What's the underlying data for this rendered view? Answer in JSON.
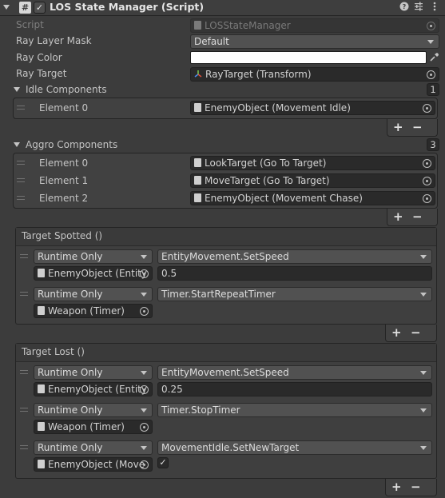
{
  "header": {
    "title": "LOS State Manager (Script)",
    "enabled_mark": "✓"
  },
  "fields": {
    "script": {
      "label": "Script",
      "value": "LOSStateManager"
    },
    "ray_layer_mask": {
      "label": "Ray Layer Mask",
      "value": "Default"
    },
    "ray_color": {
      "label": "Ray Color",
      "value": "#ffffff"
    },
    "ray_target": {
      "label": "Ray Target",
      "value": "RayTarget (Transform)"
    }
  },
  "idle": {
    "label": "Idle Components",
    "count": "1",
    "elements": [
      {
        "label": "Element 0",
        "value": "EnemyObject (Movement Idle)"
      }
    ]
  },
  "aggro": {
    "label": "Aggro Components",
    "count": "3",
    "elements": [
      {
        "label": "Element 0",
        "value": "LookTarget (Go To Target)"
      },
      {
        "label": "Element 1",
        "value": "MoveTarget (Go To Target)"
      },
      {
        "label": "Element 2",
        "value": "EnemyObject (Movement Chase)"
      }
    ]
  },
  "spotted": {
    "title": "Target Spotted ()",
    "events": [
      {
        "mode": "Runtime Only",
        "function": "EntityMovement.SetSpeed",
        "object": "EnemyObject (Entity",
        "arg": "0.5"
      },
      {
        "mode": "Runtime Only",
        "function": "Timer.StartRepeatTimer",
        "object": "Weapon (Timer)"
      }
    ]
  },
  "lost": {
    "title": "Target Lost ()",
    "events": [
      {
        "mode": "Runtime Only",
        "function": "EntityMovement.SetSpeed",
        "object": "EnemyObject (Entity",
        "arg": "0.25"
      },
      {
        "mode": "Runtime Only",
        "function": "Timer.StopTimer",
        "object": "Weapon (Timer)"
      },
      {
        "mode": "Runtime Only",
        "function": "MovementIdle.SetNewTarget",
        "object": "EnemyObject (Move",
        "checked": "✓"
      }
    ]
  },
  "buttons": {
    "plus": "+",
    "minus": "−"
  },
  "icons": {
    "header": [
      "fold-arrow-icon",
      "script-icon",
      "help-icon",
      "presets-icon",
      "kebab-menu-icon"
    ],
    "eyedropper": "eyedropper-icon",
    "object-picker": "target-picker-icon"
  }
}
